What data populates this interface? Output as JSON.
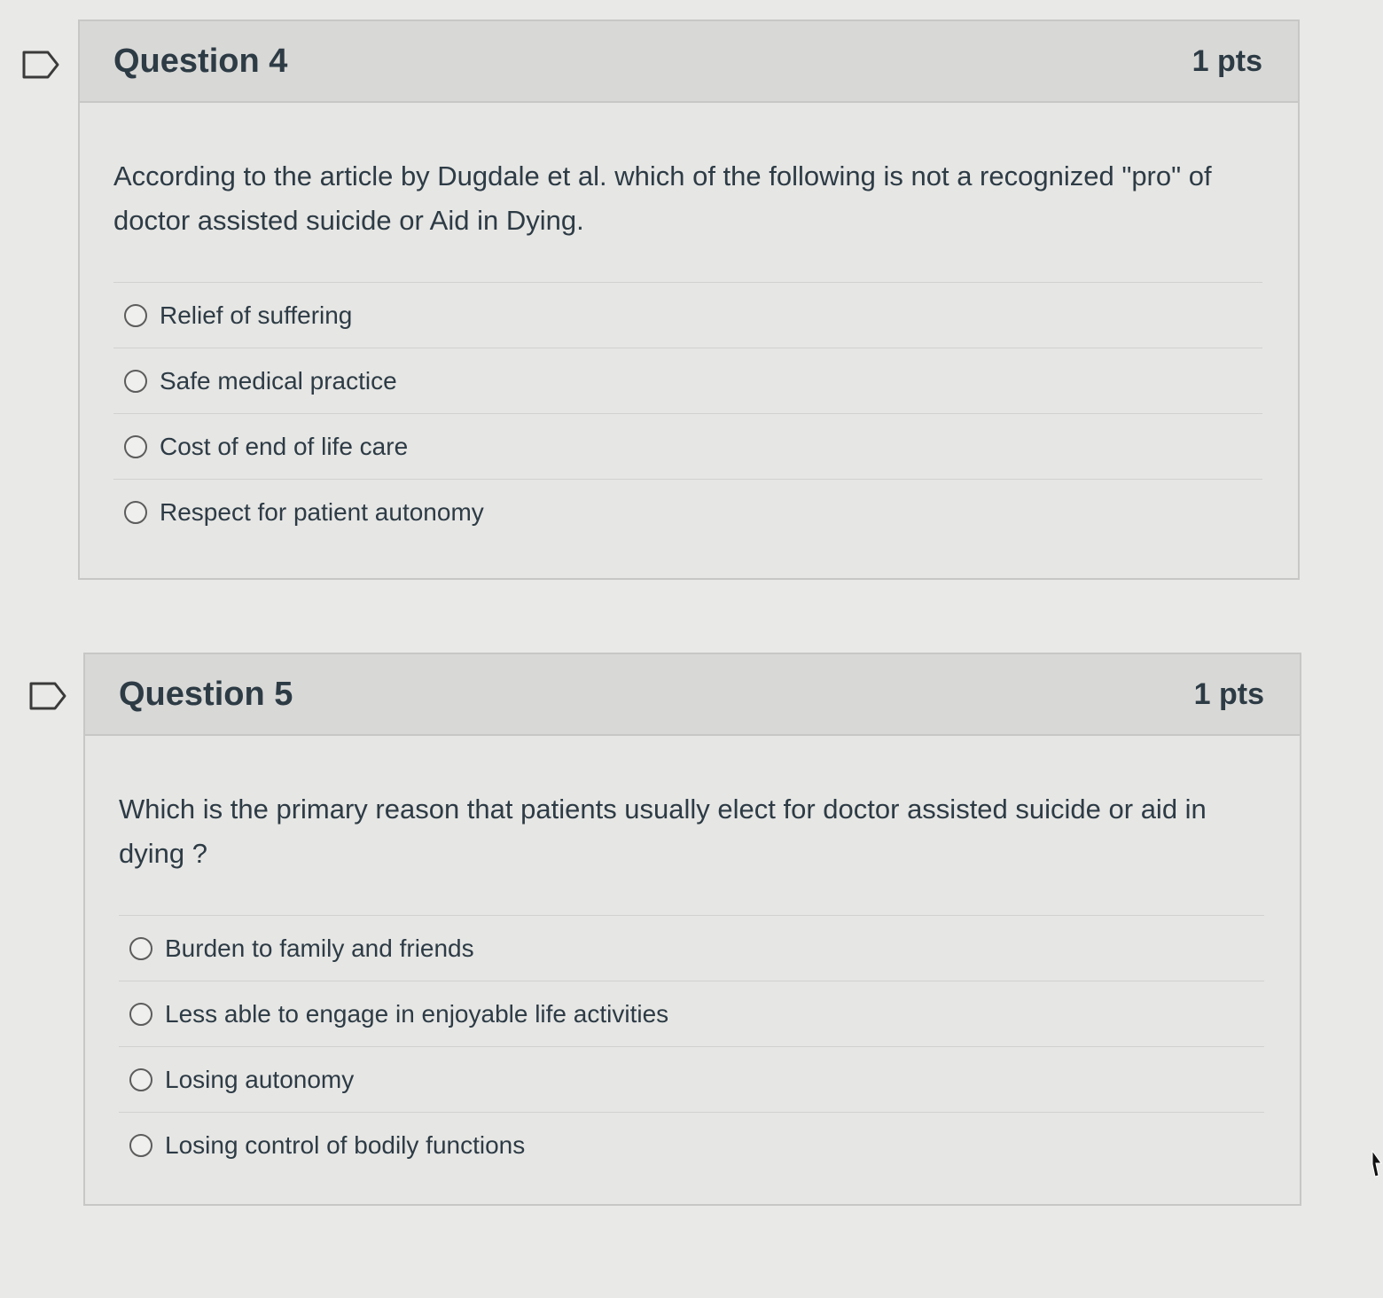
{
  "questions": [
    {
      "title": "Question 4",
      "points": "1 pts",
      "text": "According to the article by Dugdale et al. which of the following is not a recognized \"pro\" of doctor assisted suicide or Aid in Dying.",
      "answers": [
        "Relief of suffering",
        "Safe medical practice",
        "Cost of end of life care",
        "Respect for patient autonomy"
      ]
    },
    {
      "title": "Question 5",
      "points": "1 pts",
      "text": "Which is the primary reason that patients usually elect for doctor assisted suicide or aid in dying ?",
      "answers": [
        "Burden to family and friends",
        "Less able to engage in enjoyable life activities",
        "Losing autonomy",
        "Losing control of bodily functions"
      ]
    }
  ],
  "icons": {
    "flag": "flag-question-icon",
    "radio": "radio-unselected-icon",
    "cursor": "mouse-cursor-icon"
  },
  "colors": {
    "page_background": "#e9e9e7",
    "header_background": "#d8d8d6",
    "text": "#2d3b45",
    "border": "#c7c7c5"
  }
}
